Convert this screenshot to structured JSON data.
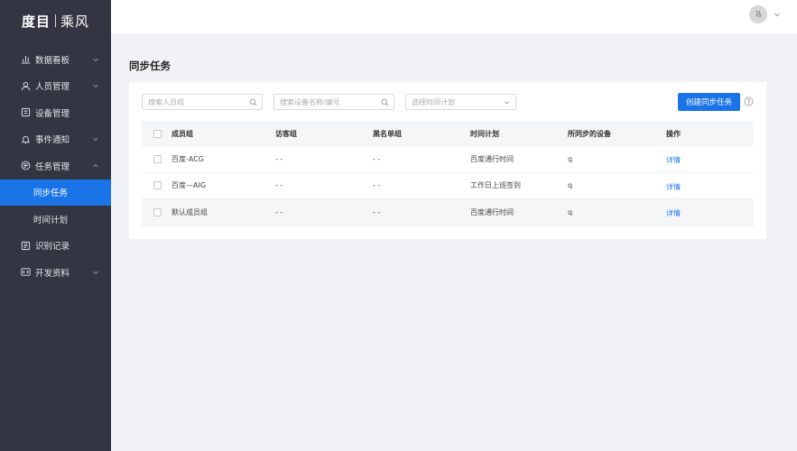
{
  "brand": {
    "logo_main": "度目",
    "logo_sub": "乘风"
  },
  "sidebar": {
    "items": [
      {
        "label": "数据看板",
        "icon": "bar-chart-icon",
        "expandable": true
      },
      {
        "label": "人员管理",
        "icon": "user-icon",
        "expandable": true
      },
      {
        "label": "设备管理",
        "icon": "device-icon",
        "expandable": false
      },
      {
        "label": "事件通知",
        "icon": "bell-icon",
        "expandable": true
      },
      {
        "label": "任务管理",
        "icon": "task-icon",
        "expandable": true,
        "expanded": true
      },
      {
        "label": "同步任务",
        "sub": true,
        "active": true
      },
      {
        "label": "时间计划",
        "sub": true
      },
      {
        "label": "识别记录",
        "icon": "record-icon",
        "expandable": false
      },
      {
        "label": "开发资料",
        "icon": "code-icon",
        "expandable": true
      }
    ]
  },
  "header": {
    "avatar_text": "马"
  },
  "main": {
    "title": "同步任务",
    "filters": {
      "member_group_placeholder": "搜索人员组",
      "device_placeholder": "搜索设备名称/编号",
      "time_plan_placeholder": "选择时间计划"
    },
    "create_button": "创建同步任务",
    "table": {
      "columns": [
        "成员组",
        "访客组",
        "黑名单组",
        "时间计划",
        "所同步的设备",
        "操作"
      ],
      "rows": [
        {
          "member": "百度-ACG",
          "visitor": "- -",
          "blacklist": "- -",
          "plan": "百度通行时间",
          "device": "q",
          "action": "详情"
        },
        {
          "member": "百度—AIG",
          "visitor": "- -",
          "blacklist": "- -",
          "plan": "工作日上班签到",
          "device": "q",
          "action": "详情"
        },
        {
          "member": "默认成员组",
          "visitor": "- -",
          "blacklist": "- -",
          "plan": "百度通行时间",
          "device": "q",
          "action": "详情"
        }
      ]
    }
  },
  "colors": {
    "accent": "#1a74e8",
    "sidebar_bg": "#333642",
    "page_bg": "#f0f2f5"
  }
}
